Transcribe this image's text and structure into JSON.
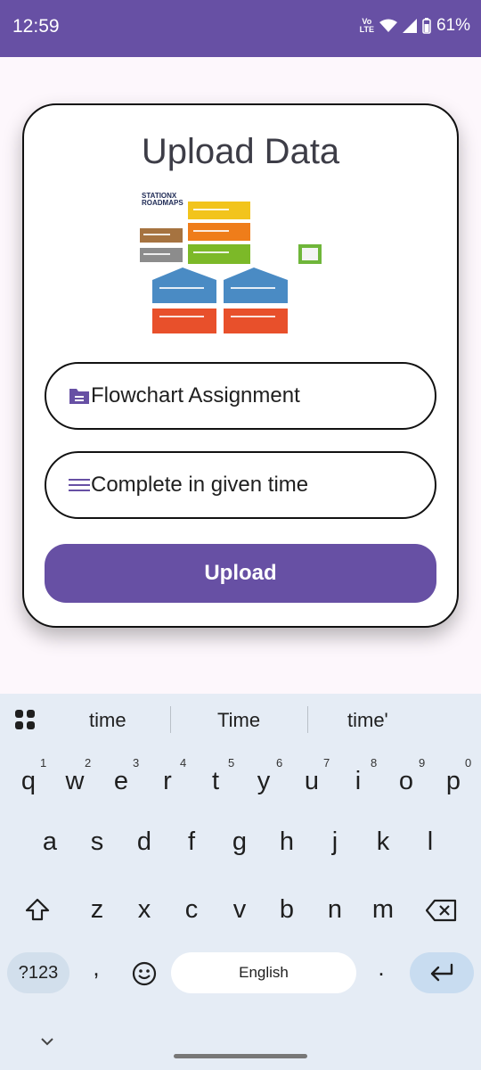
{
  "status": {
    "time": "12:59",
    "volte": "Vo LTE",
    "battery": "61%"
  },
  "card": {
    "title": "Upload Data",
    "roadmap_brand_line1": "STATIONX",
    "roadmap_brand_line2": "ROADMAPS",
    "title_field": {
      "value": "Flowchart Assignment",
      "icon": "folder-icon"
    },
    "desc_field": {
      "value": "Complete in given time",
      "icon": "lines-icon"
    },
    "upload_label": "Upload"
  },
  "keyboard": {
    "suggestions": [
      "time",
      "Time",
      "time'"
    ],
    "row1": [
      "q",
      "w",
      "e",
      "r",
      "t",
      "y",
      "u",
      "i",
      "o",
      "p"
    ],
    "row1_hints": [
      "1",
      "2",
      "3",
      "4",
      "5",
      "6",
      "7",
      "8",
      "9",
      "0"
    ],
    "row2": [
      "a",
      "s",
      "d",
      "f",
      "g",
      "h",
      "j",
      "k",
      "l"
    ],
    "row3": [
      "z",
      "x",
      "c",
      "v",
      "b",
      "n",
      "m"
    ],
    "sym_label": "?123",
    "comma": ",",
    "period": ".",
    "space_label": "English"
  },
  "colors": {
    "accent": "#6750a4",
    "keyboard_bg": "#e5ecf5"
  }
}
